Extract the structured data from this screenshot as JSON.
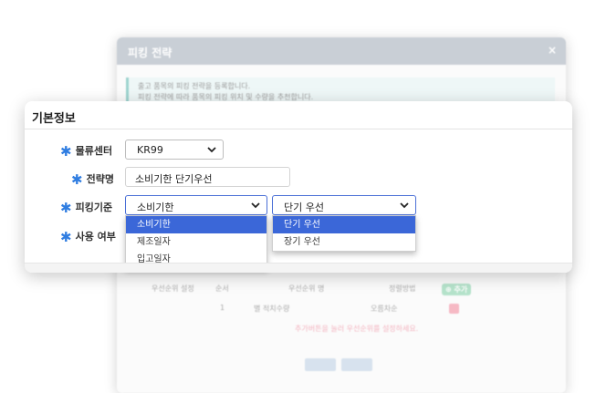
{
  "background_dialog": {
    "title": "피킹 전략",
    "close_glyph": "×",
    "info_lines": [
      "출고 품목의 피킹 전략을 등록합니다.",
      "피킹 전략에 따라 품목의 피킹 위치 및 수량을 추천합니다."
    ],
    "priority_section_label": "우선순위 설정",
    "columns": {
      "order": "순서",
      "priority_name": "우선순위 명",
      "sort": "정렬방법",
      "add": "추가"
    },
    "row": {
      "order": "1",
      "priority_name": "별 적치수량",
      "sort": "오름차순"
    },
    "empty_message": "추가버튼을 눌러 우선순위를 설정하세요."
  },
  "card": {
    "title": "기본정보",
    "fields": {
      "center_label": "물류센터",
      "center_value": "KR99",
      "strategy_label": "전략명",
      "strategy_value": "소비기한 단기우선",
      "picking_label": "피킹기준",
      "picking_primary_value": "소비기한",
      "picking_secondary_value": "단기 우선",
      "use_label": "사용 여부"
    },
    "required_glyph": "✱",
    "primary_options": [
      "소비기한",
      "제조일자",
      "입고일자"
    ],
    "secondary_options": [
      "단기 우선",
      "장기 우선"
    ]
  },
  "colors": {
    "accent": "#3b67d8",
    "required": "#2f7de1"
  }
}
